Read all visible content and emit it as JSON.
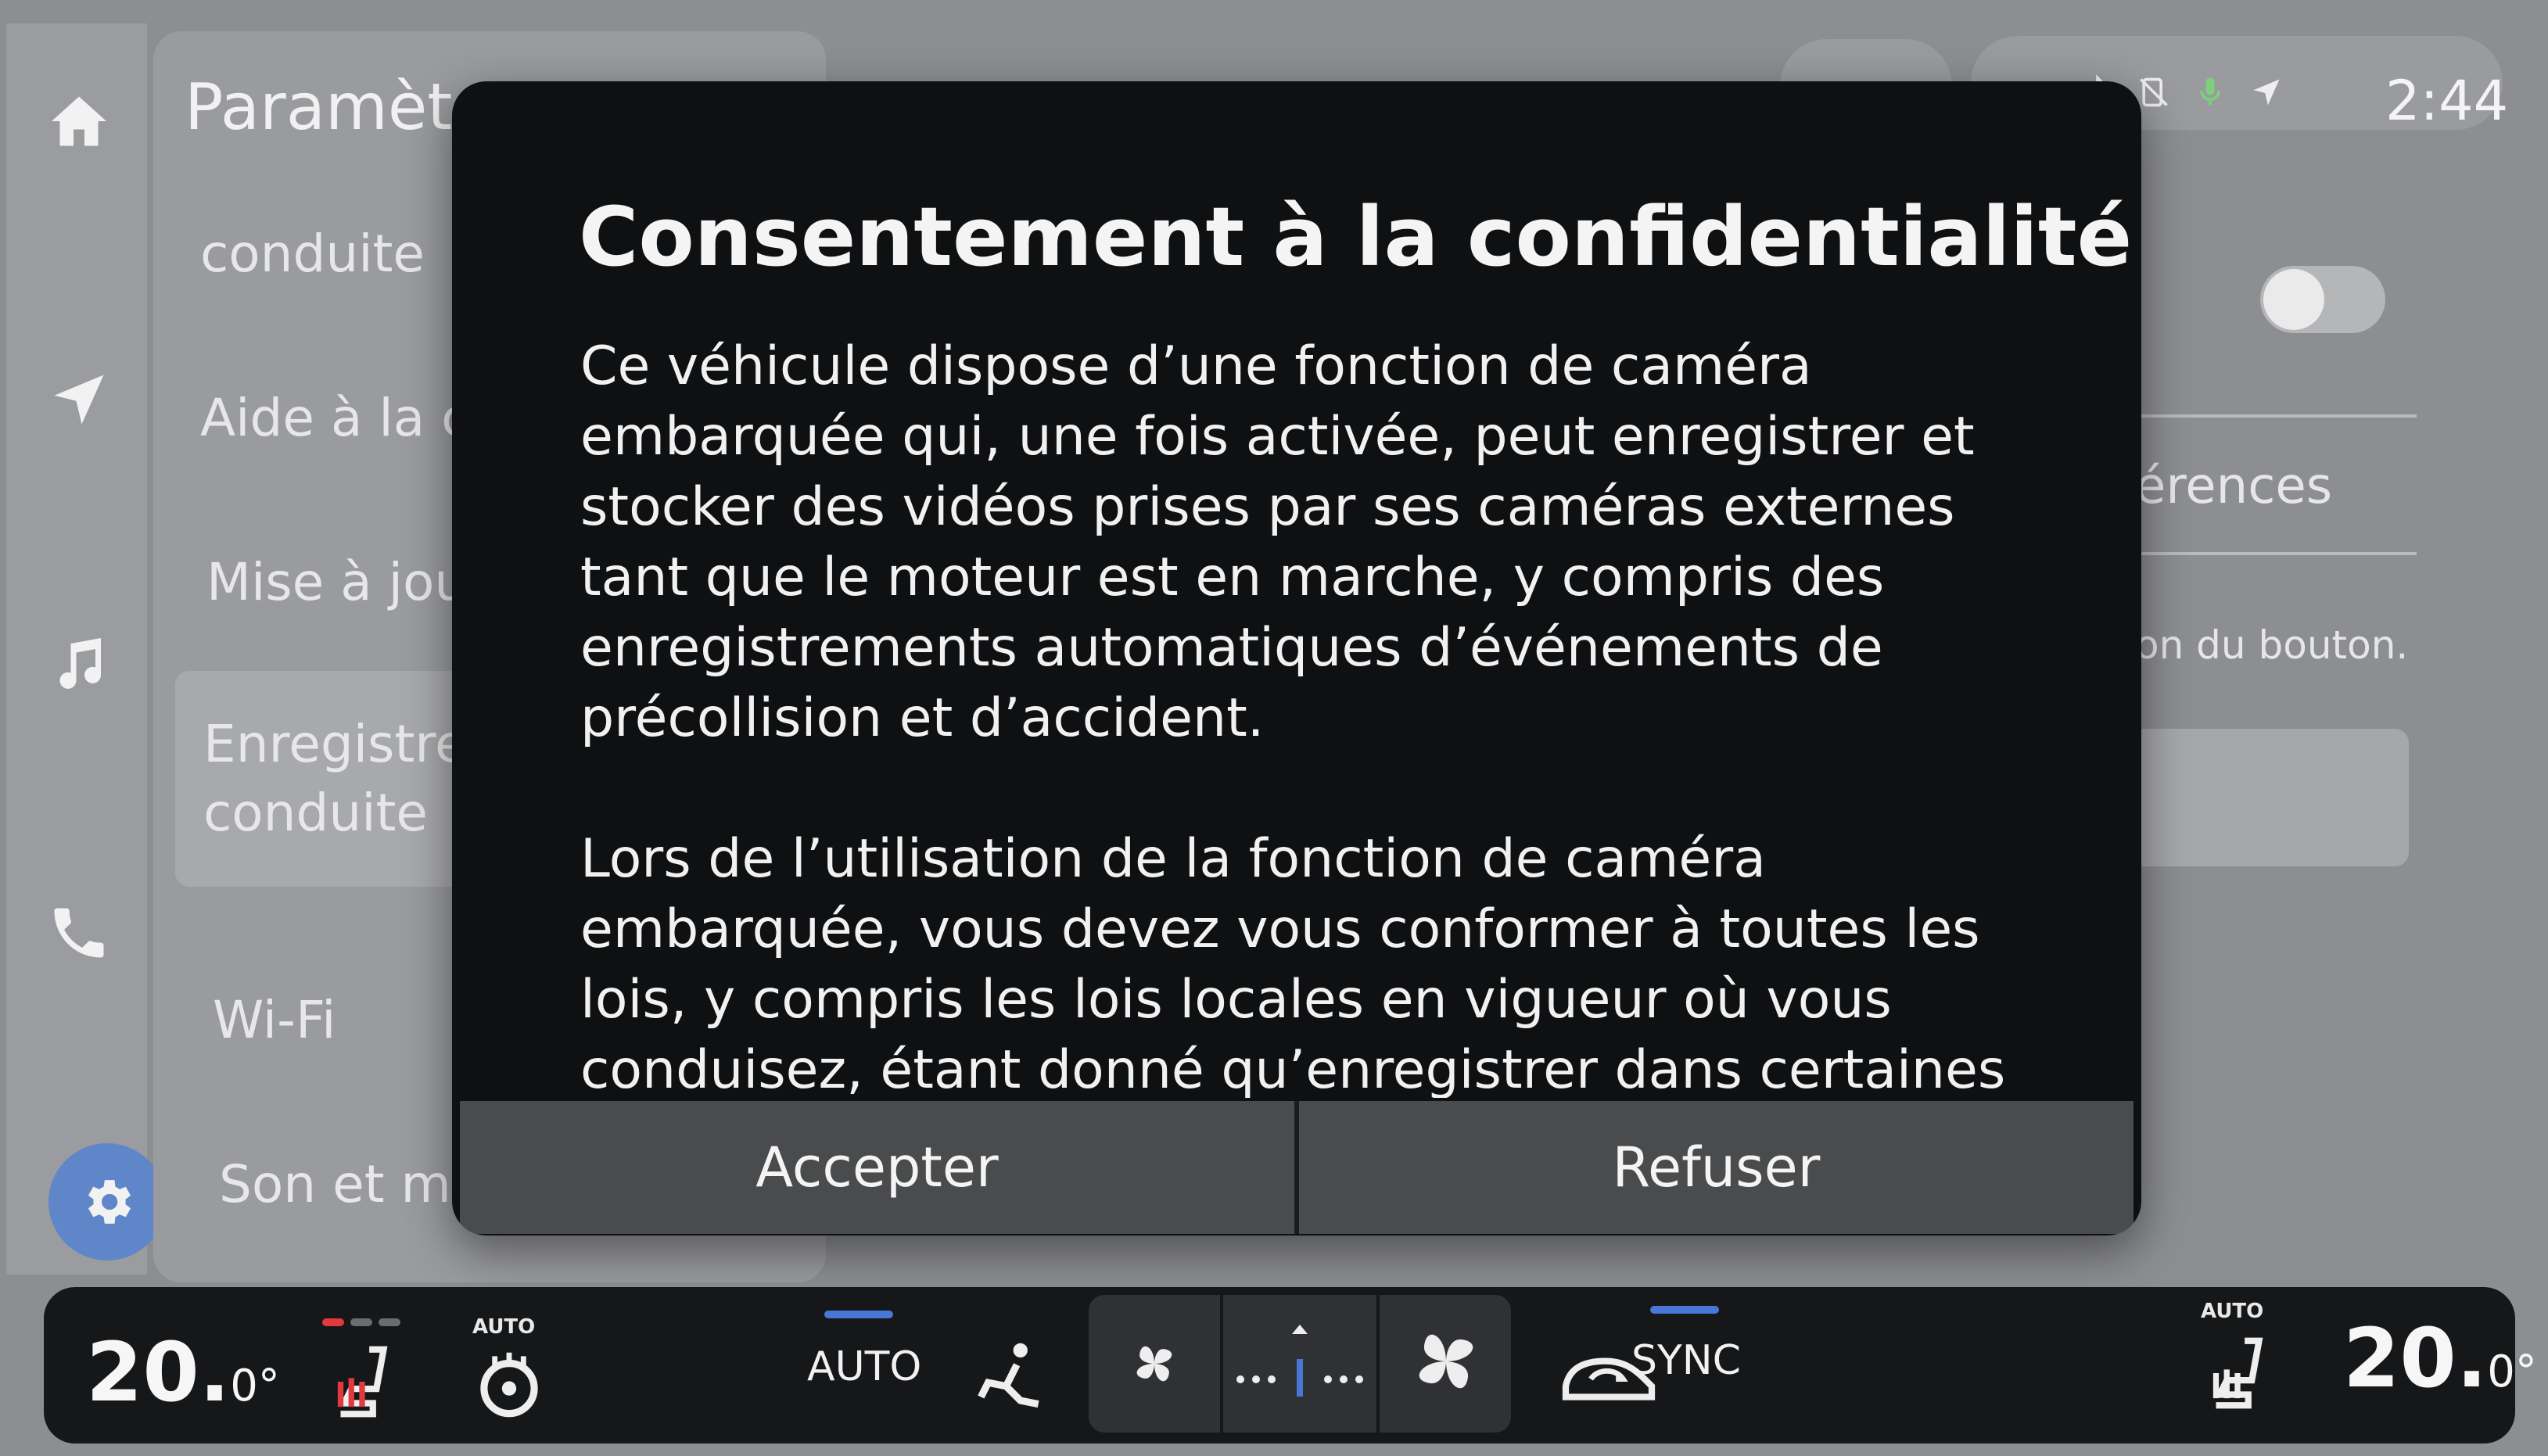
{
  "settings": {
    "title": "Paramèt",
    "items": [
      {
        "label": "conduite"
      },
      {
        "label": "Aide à la c"
      },
      {
        "label": "Mise à jou"
      },
      {
        "label_line1": "Enregistre",
        "label_line2": "conduite"
      },
      {
        "label": "Wi-Fi"
      },
      {
        "label": "Son et mé"
      }
    ]
  },
  "right_panel": {
    "preferences_label": "érences",
    "button_hint": "on du bouton."
  },
  "status": {
    "time": "2:44"
  },
  "dialog": {
    "title": "Consentement à la confidentialité",
    "paragraphs": [
      "Ce véhicule dispose d’une fonction de caméra embarquée qui, une fois activée, peut enregistrer et stocker des vidéos prises par ses caméras externes tant que le moteur est en marche, y compris des enregistrements automatiques d’événements de précollision et d’accident.",
      "Lors de l’utilisation de la fonction de caméra embarquée, vous devez vous conformer à toutes les lois, y compris les lois locales en vigueur où vous conduisez, étant donné qu’enregistrer dans certaines zones peut être interdit."
    ],
    "accept_label": "Accepter",
    "refuse_label": "Refuser"
  },
  "climate": {
    "left_temp": "20.",
    "left_temp_decimal": "0°",
    "right_temp": "20.",
    "right_temp_decimal": "0°",
    "auto_label": "AUTO",
    "sync_label": "SYNC",
    "seat_auto_label": "AUTO",
    "accent_color": "#4877d8",
    "heat_color": "#e0393e"
  }
}
